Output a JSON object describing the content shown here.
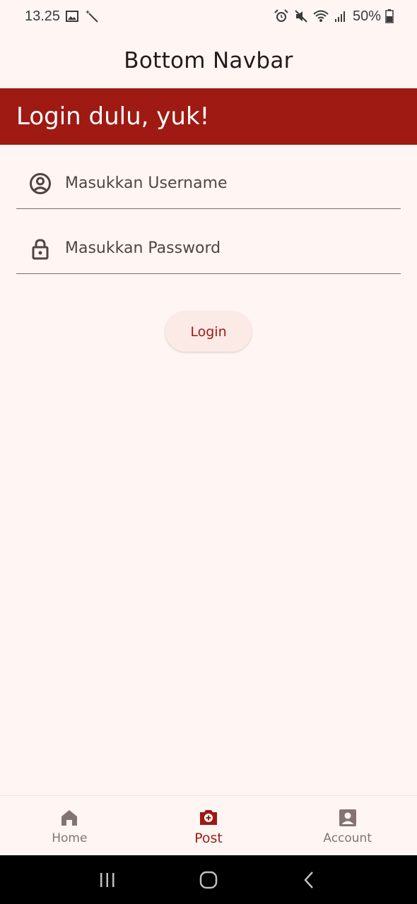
{
  "status_bar": {
    "time": "13.25",
    "battery": "50%",
    "left_icons": [
      "image-icon",
      "magic-wand-icon"
    ],
    "right_icons": [
      "alarm-icon",
      "mute-icon",
      "wifi-icon",
      "signal-icon",
      "battery-icon"
    ]
  },
  "app_bar": {
    "title": "Bottom Navbar"
  },
  "banner": {
    "text": "Login dulu, yuk!"
  },
  "form": {
    "username": {
      "placeholder": "Masukkan Username",
      "value": "",
      "icon": "account-circle-icon"
    },
    "password": {
      "placeholder": "Masukkan Password",
      "value": "",
      "icon": "lock-icon"
    },
    "login_label": "Login"
  },
  "bottom_nav": {
    "items": [
      {
        "label": "Home",
        "icon": "home-icon",
        "active": false
      },
      {
        "label": "Post",
        "icon": "camera-icon",
        "active": true
      },
      {
        "label": "Account",
        "icon": "account-box-icon",
        "active": false
      }
    ]
  },
  "colors": {
    "primary": "#9e1a12",
    "background": "#fff6f4",
    "on_surface_variant": "#534341",
    "inactive_nav": "#857371"
  }
}
